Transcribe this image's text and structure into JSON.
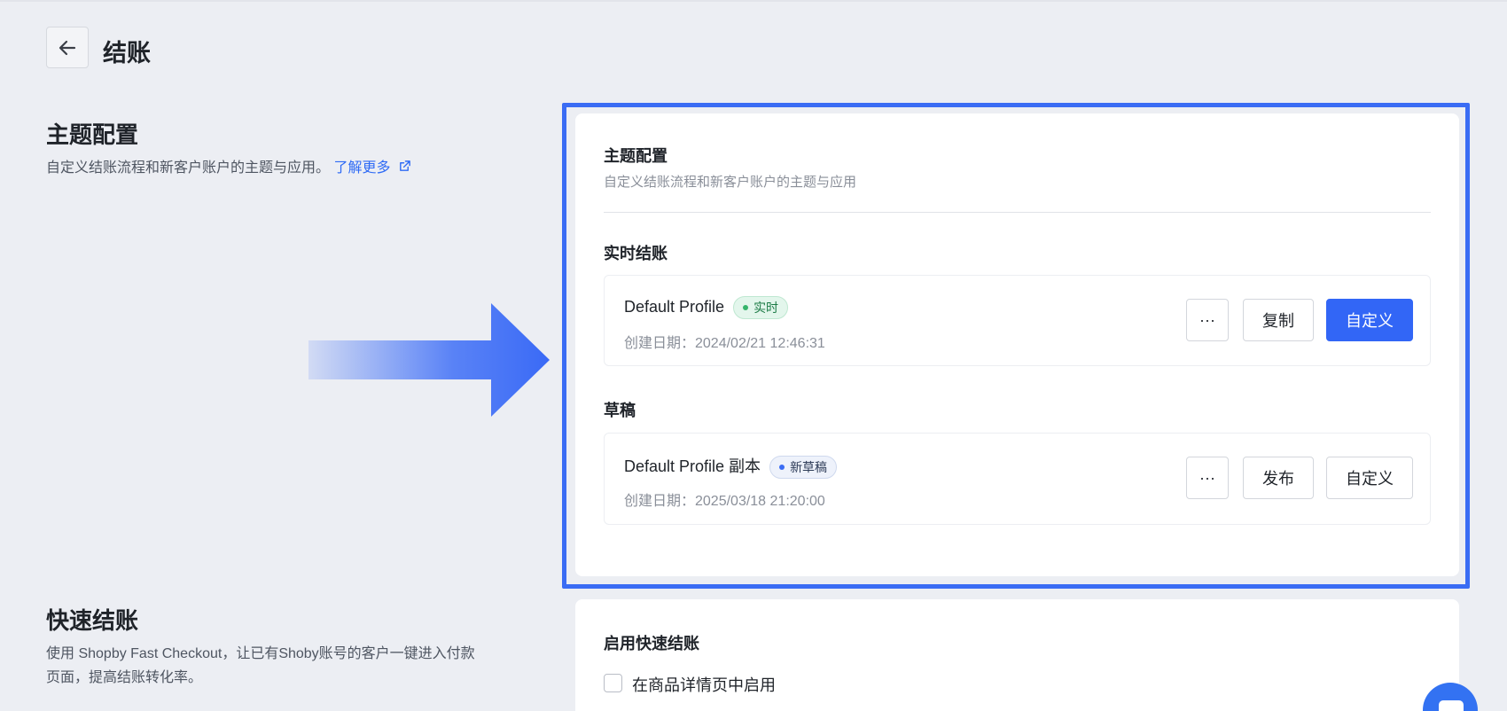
{
  "header": {
    "title": "结账"
  },
  "theme_section": {
    "title": "主题配置",
    "description": "自定义结账流程和新客户账户的主题与应用。",
    "link": "了解更多"
  },
  "theme_card": {
    "title": "主题配置",
    "subtitle": "自定义结账流程和新客户账户的主题与应用",
    "live_heading": "实时结账",
    "live_profile": {
      "name": "Default Profile",
      "badge": "实时",
      "date": "创建日期：2024/02/21 12:46:31",
      "more": "···",
      "copy": "复制",
      "customize": "自定义"
    },
    "draft_heading": "草稿",
    "draft_profile": {
      "name": "Default Profile 副本",
      "badge": "新草稿",
      "date": "创建日期：2025/03/18 21:20:00",
      "more": "···",
      "publish": "发布",
      "customize": "自定义"
    }
  },
  "fast_section": {
    "title": "快速结账",
    "description_line1": "使用 Shopby Fast Checkout，让已有Shoby账号的客户一键进入付款",
    "description_line2": "页面，提高结账转化率。"
  },
  "fast_card": {
    "title": "启用快速结账",
    "checkbox_label": "在商品详情页中启用",
    "checkbox_checked": false
  },
  "colors": {
    "accent": "#3266f6",
    "highlight_border": "#3a6cf4",
    "live_badge": "#e3f6ec",
    "draft_badge": "#eef2fb"
  },
  "icons": {
    "back": "arrow-left-icon",
    "external_link": "external-link-icon",
    "annotation_arrow": "right-arrow-icon",
    "chat": "chat-icon"
  }
}
